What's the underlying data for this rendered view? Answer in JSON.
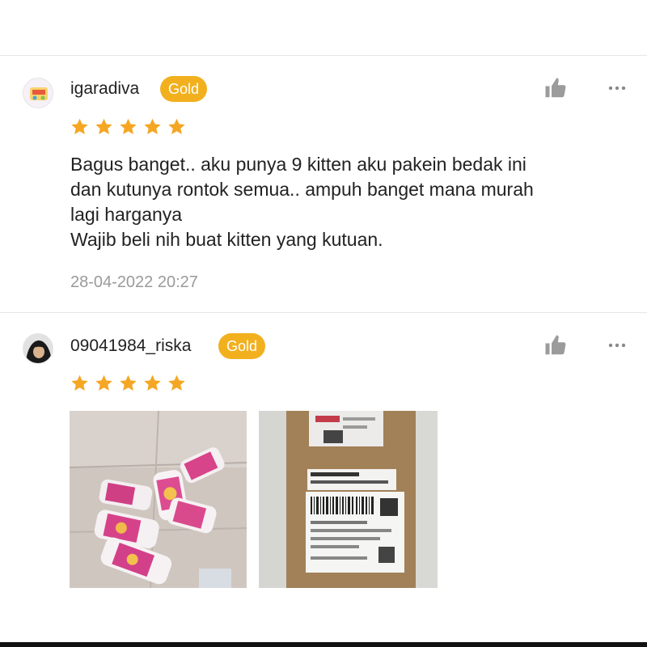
{
  "reviews": [
    {
      "username": "igaradiva",
      "badge": "Gold",
      "rating": 5,
      "text": "Bagus banget.. aku punya 9 kitten aku pakein bedak ini\ndan kutunya rontok semua.. ampuh banget mana murah\nlagi harganya\nWajib beli nih buat kitten yang kutuan.",
      "timestamp": "28-04-2022 20:27",
      "icons": {
        "like": "thumbs-up-icon",
        "more": "more-dots-icon"
      }
    },
    {
      "username": "09041984_riska",
      "badge": "Gold",
      "rating": 5,
      "photos": [
        "product-bottles-photo",
        "package-box-photo"
      ],
      "icons": {
        "like": "thumbs-up-icon",
        "more": "more-dots-icon"
      }
    }
  ],
  "colors": {
    "badge": "#f2b01e",
    "star": "#f5a623",
    "timestamp": "#9a9a9a",
    "icon": "#9b9b9b"
  }
}
